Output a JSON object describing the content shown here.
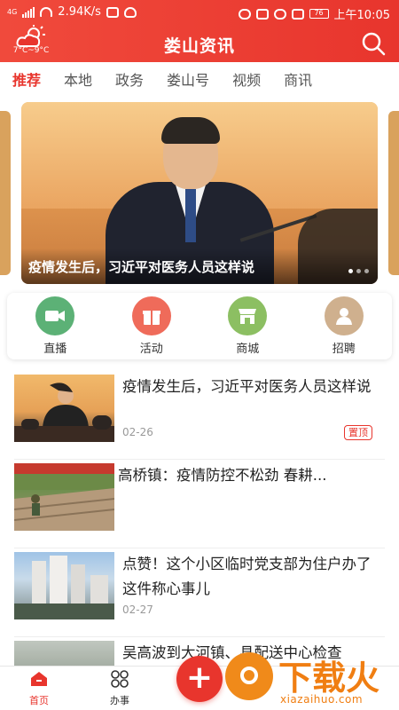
{
  "status_bar": {
    "network": "4G",
    "speed": "2.94K/s",
    "battery": "76",
    "time": "上午10:05"
  },
  "header": {
    "title": "娄山资讯",
    "weather_temp": "7°C~9°C"
  },
  "tabs": [
    {
      "label": "推荐",
      "active": true
    },
    {
      "label": "本地"
    },
    {
      "label": "政务"
    },
    {
      "label": "娄山号"
    },
    {
      "label": "视频"
    },
    {
      "label": "商讯"
    }
  ],
  "banner": {
    "caption": "疫情发生后，习近平对医务人员这样说"
  },
  "quick_actions": [
    {
      "label": "直播",
      "icon": "video-icon",
      "color": "#5cb176"
    },
    {
      "label": "活动",
      "icon": "gift-icon",
      "color": "#ef6b5a"
    },
    {
      "label": "商城",
      "icon": "shop-icon",
      "color": "#8cbf62"
    },
    {
      "label": "招聘",
      "icon": "person-icon",
      "color": "#cfb08e"
    }
  ],
  "news": [
    {
      "title": "疫情发生后，习近平对医务人员这样说",
      "date": "02-26",
      "badge": "置顶"
    },
    {
      "title": "高桥镇：疫情防控不松劲 春耕...",
      "date": ""
    },
    {
      "title": "点赞！这个小区临时党支部为住户办了这件称心事儿",
      "date": "02-27"
    },
    {
      "title": "吴高波到大河镇、县配送中心检查",
      "date": ""
    }
  ],
  "bottom_nav": {
    "home_label": "首页",
    "work_label": "办事",
    "plus_label": "+"
  },
  "watermark": {
    "text": "下载火",
    "sub": "xiazaihuo.com"
  }
}
